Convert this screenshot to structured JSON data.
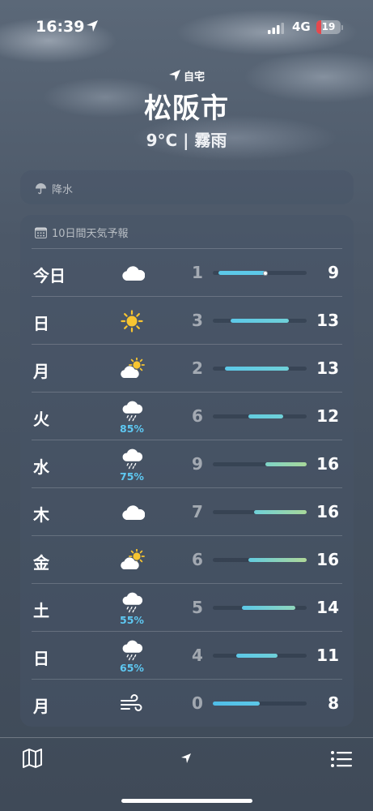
{
  "status_bar": {
    "time": "16:39",
    "network": "4G",
    "battery_level": "19",
    "battery_fraction": 0.19,
    "colors": {
      "battery_low": "#e5484d"
    }
  },
  "header": {
    "home_label": "自宅",
    "city": "松阪市",
    "current": "9°C | 霧雨"
  },
  "precipitation": {
    "label": "降水",
    "icon": "umbrella-icon"
  },
  "forecast": {
    "title": "10日間天気予報",
    "icon": "calendar-icon",
    "range_min": 0,
    "range_max": 16,
    "current_temp": 9,
    "days": [
      {
        "day": "今日",
        "icon": "cloud-icon",
        "precip": "",
        "low": "1",
        "high": "9",
        "lo": 1,
        "hi": 9,
        "colors": [
          "#5cc8e8",
          "#5cc8e8"
        ],
        "now": true
      },
      {
        "day": "日",
        "icon": "sun-icon",
        "precip": "",
        "low": "3",
        "high": "13",
        "lo": 3,
        "hi": 13,
        "colors": [
          "#5cc8e8",
          "#6fd0d8"
        ]
      },
      {
        "day": "月",
        "icon": "partly-cloudy-icon",
        "precip": "",
        "low": "2",
        "high": "13",
        "lo": 2,
        "hi": 13,
        "colors": [
          "#5cc8e8",
          "#6fd0d8"
        ]
      },
      {
        "day": "火",
        "icon": "rain-icon",
        "precip": "85%",
        "low": "6",
        "high": "12",
        "lo": 6,
        "hi": 12,
        "colors": [
          "#62cce0",
          "#6fd0d8"
        ]
      },
      {
        "day": "水",
        "icon": "rain-icon",
        "precip": "75%",
        "low": "9",
        "high": "16",
        "lo": 9,
        "hi": 16,
        "colors": [
          "#7ed4c8",
          "#a8d89a"
        ]
      },
      {
        "day": "木",
        "icon": "cloud-icon",
        "precip": "",
        "low": "7",
        "high": "16",
        "lo": 7,
        "hi": 16,
        "colors": [
          "#6fd0d8",
          "#a8d89a"
        ]
      },
      {
        "day": "金",
        "icon": "partly-cloudy-icon",
        "precip": "",
        "low": "6",
        "high": "16",
        "lo": 6,
        "hi": 16,
        "colors": [
          "#62cce0",
          "#b0d898"
        ]
      },
      {
        "day": "土",
        "icon": "rain-icon",
        "precip": "55%",
        "low": "5",
        "high": "14",
        "lo": 5,
        "hi": 14,
        "colors": [
          "#5cc8e8",
          "#8fd6bc"
        ]
      },
      {
        "day": "日",
        "icon": "rain-icon",
        "precip": "65%",
        "low": "4",
        "high": "11",
        "lo": 4,
        "hi": 11,
        "colors": [
          "#5cc8e8",
          "#6fd0d8"
        ]
      },
      {
        "day": "月",
        "icon": "wind-icon",
        "precip": "",
        "low": "0",
        "high": "8",
        "lo": 0,
        "hi": 8,
        "colors": [
          "#4fbde8",
          "#5cc8e8"
        ]
      }
    ]
  },
  "toolbar": {
    "map": "map-icon",
    "location": "location-arrow-icon",
    "list": "list-icon"
  }
}
